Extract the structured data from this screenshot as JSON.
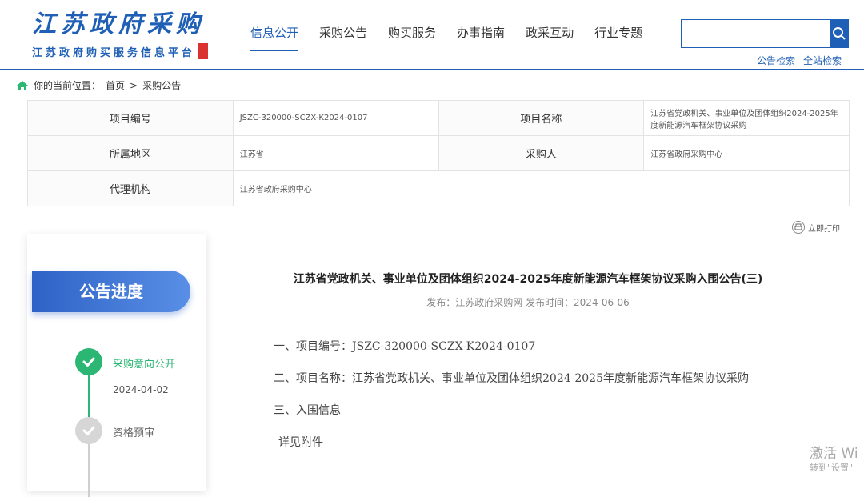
{
  "header": {
    "logo_title": "江苏政府采购",
    "logo_subtitle": "江苏政府购买服务信息平台",
    "nav": [
      "信息公开",
      "采购公告",
      "购买服务",
      "办事指南",
      "政采互动",
      "行业专题"
    ],
    "search_placeholder": "",
    "search_links": [
      "公告检索",
      "全站检索"
    ]
  },
  "breadcrumb": {
    "prefix": "你的当前位置：",
    "home": "首页",
    "separator": ">",
    "current": "采购公告"
  },
  "info": {
    "rows": [
      {
        "label1": "项目编号",
        "value1": "JSZC-320000-SCZX-K2024-0107",
        "label2": "项目名称",
        "value2": "江苏省党政机关、事业单位及团体组织2024-2025年度新能源汽车框架协议采购"
      },
      {
        "label1": "所属地区",
        "value1": "江苏省",
        "label2": "采购人",
        "value2": "江苏省政府采购中心"
      },
      {
        "label1": "代理机构",
        "value1": "江苏省政府采购中心"
      }
    ]
  },
  "print_label": "立即打印",
  "progress": {
    "title": "公告进度",
    "steps": [
      {
        "label": "采购意向公开",
        "date": "2024-04-02"
      },
      {
        "label": "资格预审"
      }
    ]
  },
  "article": {
    "title": "江苏省党政机关、事业单位及团体组织2024-2025年度新能源汽车框架协议采购入围公告(三)",
    "meta": "发布：江苏政府采购网   发布时间：2024-06-06",
    "line1": "一、项目编号：JSZC-320000-SCZX-K2024-0107",
    "line2": "二、项目名称：江苏省党政机关、事业单位及团体组织2024-2025年度新能源汽车框架协议采购",
    "line3": "三、入围信息",
    "line4": "详见附件"
  },
  "watermark": {
    "line1": "激活 Wi",
    "line2": "转到\"设置\""
  },
  "colors": {
    "brand": "#1f5fb5",
    "success": "#2bb673"
  }
}
